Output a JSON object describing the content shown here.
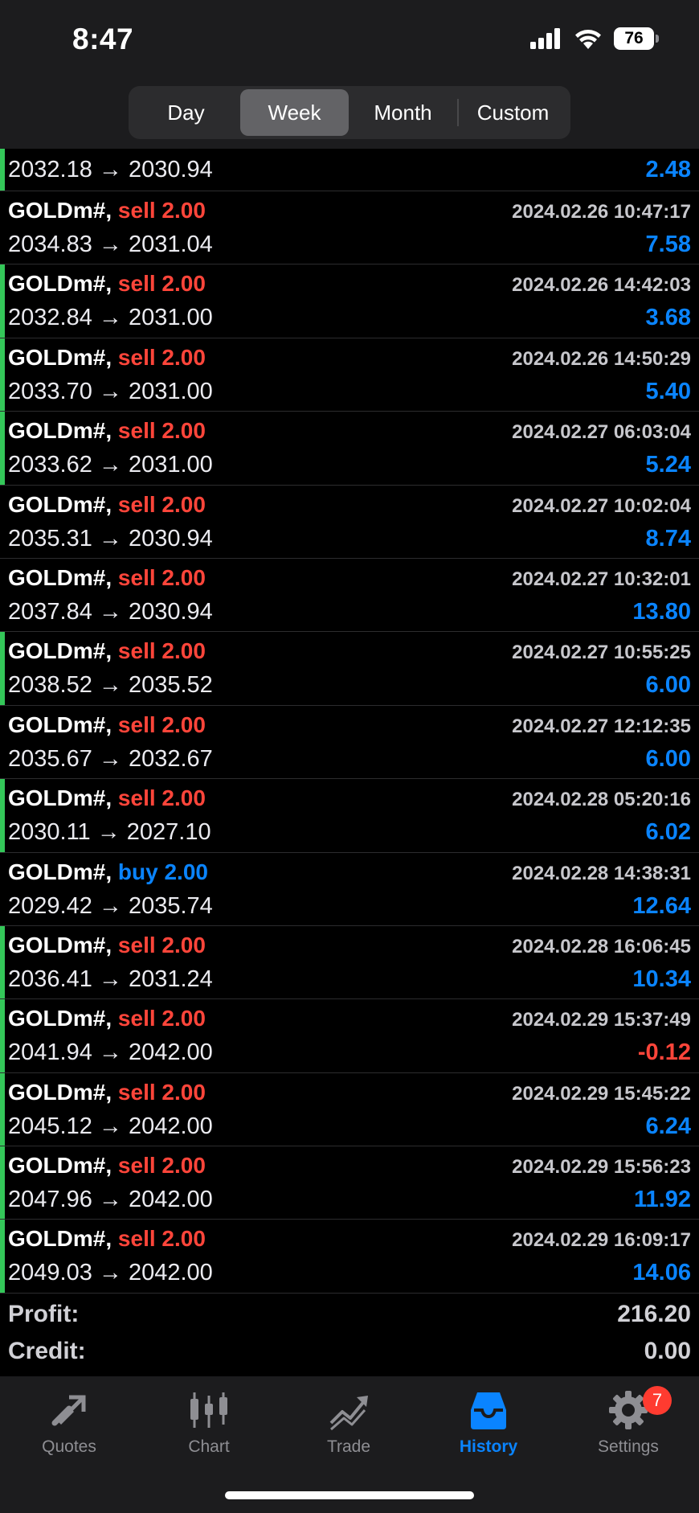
{
  "status_bar": {
    "time": "8:47",
    "battery": "76"
  },
  "periods": [
    {
      "label": "Day",
      "active": false
    },
    {
      "label": "Week",
      "active": true
    },
    {
      "label": "Month",
      "active": false
    },
    {
      "label": "Custom",
      "active": false
    }
  ],
  "partial_row": {
    "prices": "2032.18 → 2030.94",
    "profit": "2.48",
    "has_bar": true
  },
  "trades": [
    {
      "symbol": "GOLDm#,",
      "side": "sell 2.00",
      "type": "sell",
      "time": "2024.02.26 10:47:17",
      "prices": "2034.83 → 2031.04",
      "profit": "7.58",
      "has_bar": false
    },
    {
      "symbol": "GOLDm#,",
      "side": "sell 2.00",
      "type": "sell",
      "time": "2024.02.26 14:42:03",
      "prices": "2032.84 → 2031.00",
      "profit": "3.68",
      "has_bar": true
    },
    {
      "symbol": "GOLDm#,",
      "side": "sell 2.00",
      "type": "sell",
      "time": "2024.02.26 14:50:29",
      "prices": "2033.70 → 2031.00",
      "profit": "5.40",
      "has_bar": true
    },
    {
      "symbol": "GOLDm#,",
      "side": "sell 2.00",
      "type": "sell",
      "time": "2024.02.27 06:03:04",
      "prices": "2033.62 → 2031.00",
      "profit": "5.24",
      "has_bar": true
    },
    {
      "symbol": "GOLDm#,",
      "side": "sell 2.00",
      "type": "sell",
      "time": "2024.02.27 10:02:04",
      "prices": "2035.31 → 2030.94",
      "profit": "8.74",
      "has_bar": false
    },
    {
      "symbol": "GOLDm#,",
      "side": "sell 2.00",
      "type": "sell",
      "time": "2024.02.27 10:32:01",
      "prices": "2037.84 → 2030.94",
      "profit": "13.80",
      "has_bar": false
    },
    {
      "symbol": "GOLDm#,",
      "side": "sell 2.00",
      "type": "sell",
      "time": "2024.02.27 10:55:25",
      "prices": "2038.52 → 2035.52",
      "profit": "6.00",
      "has_bar": true
    },
    {
      "symbol": "GOLDm#,",
      "side": "sell 2.00",
      "type": "sell",
      "time": "2024.02.27 12:12:35",
      "prices": "2035.67 → 2032.67",
      "profit": "6.00",
      "has_bar": false
    },
    {
      "symbol": "GOLDm#,",
      "side": "sell 2.00",
      "type": "sell",
      "time": "2024.02.28 05:20:16",
      "prices": "2030.11 → 2027.10",
      "profit": "6.02",
      "has_bar": true
    },
    {
      "symbol": "GOLDm#,",
      "side": "buy 2.00",
      "type": "buy",
      "time": "2024.02.28 14:38:31",
      "prices": "2029.42 → 2035.74",
      "profit": "12.64",
      "has_bar": false
    },
    {
      "symbol": "GOLDm#,",
      "side": "sell 2.00",
      "type": "sell",
      "time": "2024.02.28 16:06:45",
      "prices": "2036.41 → 2031.24",
      "profit": "10.34",
      "has_bar": true
    },
    {
      "symbol": "GOLDm#,",
      "side": "sell 2.00",
      "type": "sell",
      "time": "2024.02.29 15:37:49",
      "prices": "2041.94 → 2042.00",
      "profit": "-0.12",
      "has_bar": true
    },
    {
      "symbol": "GOLDm#,",
      "side": "sell 2.00",
      "type": "sell",
      "time": "2024.02.29 15:45:22",
      "prices": "2045.12 → 2042.00",
      "profit": "6.24",
      "has_bar": true
    },
    {
      "symbol": "GOLDm#,",
      "side": "sell 2.00",
      "type": "sell",
      "time": "2024.02.29 15:56:23",
      "prices": "2047.96 → 2042.00",
      "profit": "11.92",
      "has_bar": true
    },
    {
      "symbol": "GOLDm#,",
      "side": "sell 2.00",
      "type": "sell",
      "time": "2024.02.29 16:09:17",
      "prices": "2049.03 → 2042.00",
      "profit": "14.06",
      "has_bar": true
    }
  ],
  "summary": {
    "profit_label": "Profit:",
    "profit_value": "216.20",
    "credit_label": "Credit:",
    "credit_value": "0.00"
  },
  "colors": {
    "sell": "#ff453a",
    "buy": "#0a84ff",
    "profit_positive": "#0a84ff",
    "profit_negative": "#ff453a",
    "row_bar": "#34c759"
  },
  "tabs": [
    {
      "label": "Quotes",
      "icon": "quotes-icon",
      "active": false
    },
    {
      "label": "Chart",
      "icon": "candlestick-icon",
      "active": false
    },
    {
      "label": "Trade",
      "icon": "trade-icon",
      "active": false
    },
    {
      "label": "History",
      "icon": "inbox-icon",
      "active": true
    },
    {
      "label": "Settings",
      "icon": "gear-icon",
      "active": false,
      "badge": "7"
    }
  ]
}
